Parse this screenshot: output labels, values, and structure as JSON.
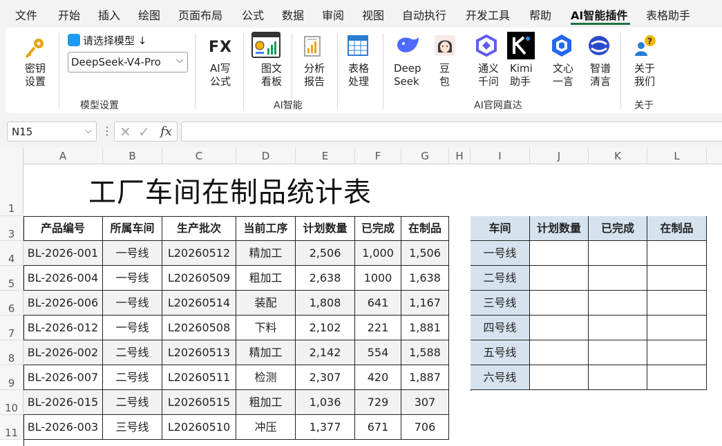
{
  "menu": [
    "文件",
    "开始",
    "插入",
    "绘图",
    "页面布局",
    "公式",
    "数据",
    "审阅",
    "视图",
    "自动执行",
    "开发工具",
    "帮助",
    "AI智能插件",
    "表格助手"
  ],
  "menu_active": "AI智能插件",
  "ribbon": {
    "key_button": [
      "密钥",
      "设置"
    ],
    "model_prompt": "请选择模型",
    "model_prompt_arrow": "↓",
    "model_select": "DeepSeek-V4-Pro",
    "group_model": "模型设置",
    "fx_label": "FX",
    "ai_formula": [
      "AI写",
      "公式"
    ],
    "chart_board": [
      "图文",
      "看板"
    ],
    "analysis_report": [
      "分析",
      "报告"
    ],
    "table_process": [
      "表格",
      "处理"
    ],
    "group_ai": "AI智能",
    "deepseek": [
      "Deep",
      "Seek"
    ],
    "doubao": [
      "豆",
      "包"
    ],
    "tongyi": [
      "通义",
      "千问"
    ],
    "kimi": [
      "Kimi",
      "助手"
    ],
    "wenxin": [
      "文心",
      "一言"
    ],
    "zhipu": [
      "智谱",
      "清言"
    ],
    "group_sites": "AI官网直达",
    "about": [
      "关于",
      "我们"
    ],
    "group_about": "关于"
  },
  "formula_bar": {
    "name_box": "N15",
    "fx": "fx",
    "value": ""
  },
  "columns": [
    "A",
    "B",
    "C",
    "D",
    "E",
    "F",
    "G",
    "H",
    "I",
    "J",
    "K",
    "L"
  ],
  "rows": [
    "1",
    "3",
    "4",
    "5",
    "6",
    "7",
    "8",
    "9",
    "10",
    "11"
  ],
  "sheet_title": "工厂车间在制品统计表",
  "table": {
    "headers": [
      "产品编号",
      "所属车间",
      "生产批次",
      "当前工序",
      "计划数量",
      "已完成",
      "在制品"
    ],
    "rows": [
      [
        "BL-2026-001",
        "一号线",
        "L20260512",
        "精加工",
        "2,506",
        "1,000",
        "1,506"
      ],
      [
        "BL-2026-004",
        "一号线",
        "L20260509",
        "粗加工",
        "2,638",
        "1000",
        "1,638"
      ],
      [
        "BL-2026-006",
        "一号线",
        "L20260514",
        "装配",
        "1,808",
        "641",
        "1,167"
      ],
      [
        "BL-2026-012",
        "一号线",
        "L20260508",
        "下料",
        "2,102",
        "221",
        "1,881"
      ],
      [
        "BL-2026-002",
        "二号线",
        "L20260513",
        "精加工",
        "2,142",
        "554",
        "1,588"
      ],
      [
        "BL-2026-007",
        "二号线",
        "L20260511",
        "检测",
        "2,307",
        "420",
        "1,887"
      ],
      [
        "BL-2026-015",
        "二号线",
        "L20260515",
        "粗加工",
        "1,036",
        "729",
        "307"
      ],
      [
        "BL-2026-003",
        "三号线",
        "L20260510",
        "冲压",
        "1,377",
        "671",
        "706"
      ]
    ]
  },
  "summary": {
    "headers": [
      "车间",
      "计划数量",
      "已完成",
      "在制品"
    ],
    "lines": [
      "一号线",
      "二号线",
      "三号线",
      "四号线",
      "五号线",
      "六号线"
    ]
  },
  "colors": {
    "accent": "#1e7145",
    "summary_header": "#d6e3ee",
    "row_gray": "#f2f2f2"
  }
}
